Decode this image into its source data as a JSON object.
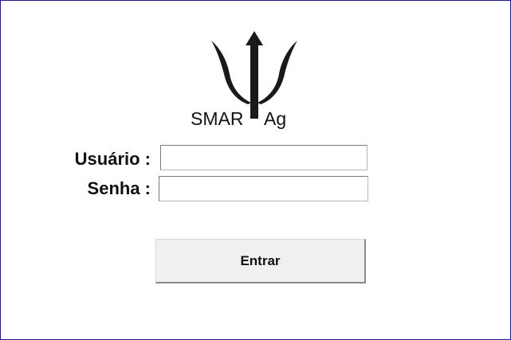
{
  "app": {
    "brand_left": "SMAR",
    "brand_right": "Ag",
    "logo_icon": "trident-icon"
  },
  "login": {
    "username_label": "Usuário :",
    "username_value": "",
    "password_label": "Senha :",
    "password_value": "",
    "submit_label": "Entrar"
  },
  "colors": {
    "window_border": "#1b1a8c",
    "logo": "#1a1a1a",
    "button_bg": "#f0f0f0"
  }
}
